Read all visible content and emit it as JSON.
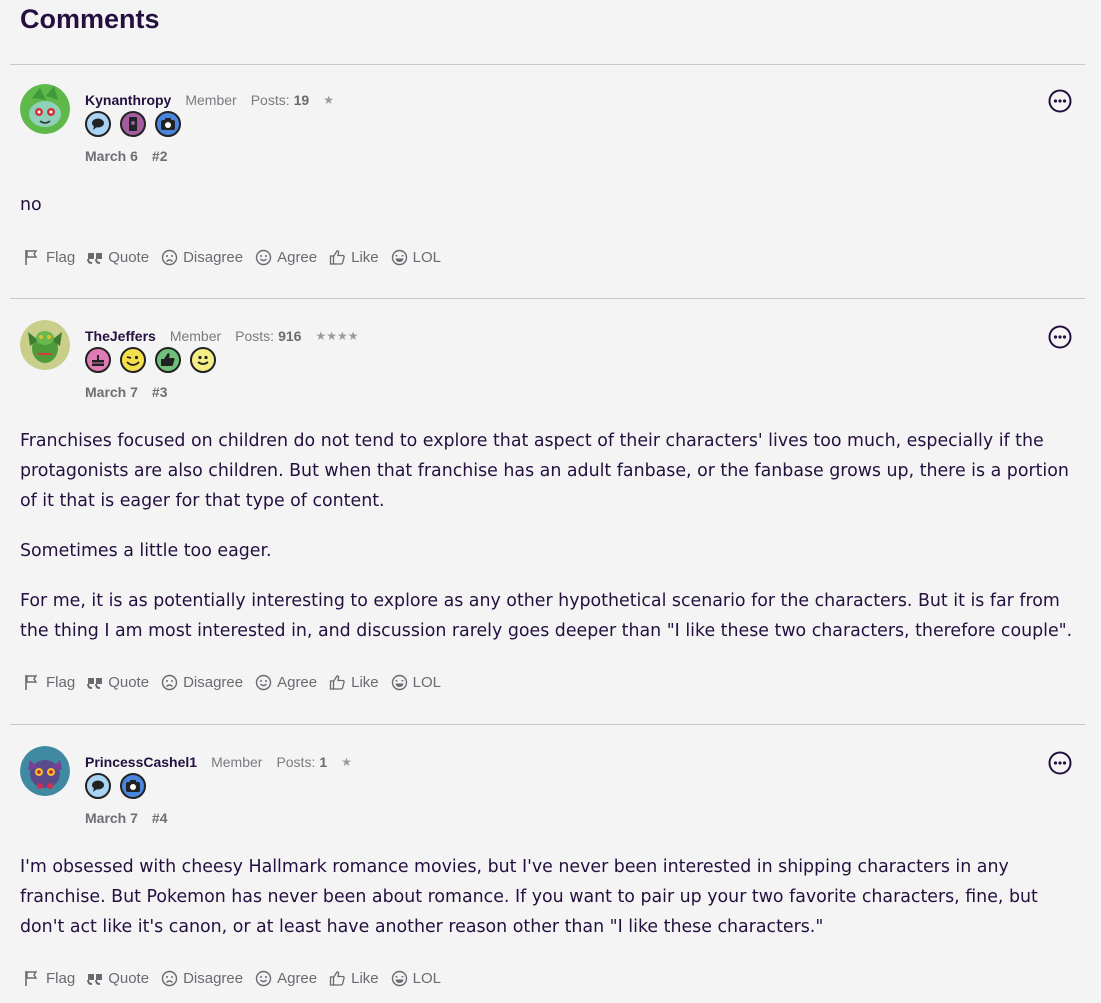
{
  "section_title": "Comments",
  "action_labels": {
    "flag": "Flag",
    "quote": "Quote",
    "disagree": "Disagree",
    "agree": "Agree",
    "like": "Like",
    "lol": "LOL"
  },
  "comments": [
    {
      "username": "Kynanthropy",
      "role": "Member",
      "posts_label": "Posts:",
      "posts_count": "19",
      "stars": "★",
      "badges": [
        "speech-bubble-badge",
        "phone-badge",
        "camera-badge"
      ],
      "date": "March 6",
      "number": "#2",
      "paragraphs": [
        "no"
      ]
    },
    {
      "username": "TheJeffers",
      "role": "Member",
      "posts_label": "Posts:",
      "posts_count": "916",
      "stars": "★★★★",
      "badges": [
        "cake-badge",
        "wink-badge",
        "thumbs-up-badge",
        "smile-badge"
      ],
      "date": "March 7",
      "number": "#3",
      "paragraphs": [
        "Franchises focused on children do not tend to explore that aspect of their characters' lives too much, especially if the protagonists are also children. But when that franchise has an adult fanbase, or the fanbase grows up, there is a portion of it that is eager for that type of content.",
        "Sometimes a little too eager.",
        "For me, it is as potentially interesting to explore as any other hypothetical scenario for the characters. But it is far from the thing I am most interested in, and discussion rarely goes deeper than \"I like these two characters, therefore couple\"."
      ]
    },
    {
      "username": "PrincessCashel1",
      "role": "Member",
      "posts_label": "Posts:",
      "posts_count": "1",
      "stars": "★",
      "badges": [
        "speech-bubble-badge",
        "camera-badge"
      ],
      "date": "March 7",
      "number": "#4",
      "paragraphs": [
        "I'm obsessed with cheesy Hallmark romance movies, but I've never been interested in shipping characters in any franchise. But Pokemon has never been about romance. If you want to pair up your two favorite characters, fine, but don't act like it's canon, or at least have another reason other than \"I like these characters.\""
      ]
    }
  ]
}
